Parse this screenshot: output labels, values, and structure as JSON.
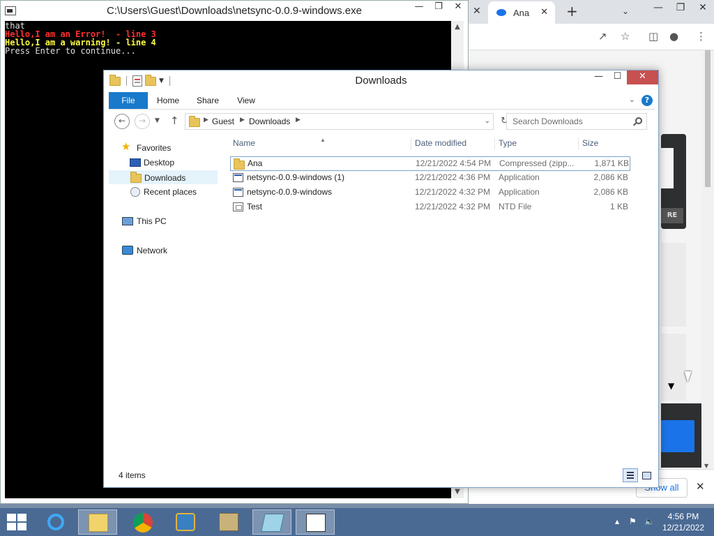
{
  "console": {
    "title": "C:\\Users\\Guest\\Downloads\\netsync-0.0.9-windows.exe",
    "lines": {
      "l1": "that",
      "l2": "Hello,I am an Error!  - line 3",
      "l3": "Hello,I am a warning! - line 4",
      "l4": "Press Enter to continue..."
    },
    "colors": {
      "error": "#ff3030",
      "warning": "#ffff40",
      "normal": "#e0e0e0"
    }
  },
  "browser": {
    "tab_label": "Ana",
    "partial_button": "RE",
    "show_all": "Show all",
    "accent": "#1a73e8"
  },
  "explorer": {
    "title": "Downloads",
    "ribbon": {
      "file": "File",
      "home": "Home",
      "share": "Share",
      "view": "View"
    },
    "address": {
      "segments": [
        "Guest",
        "Downloads"
      ]
    },
    "search_placeholder": "Search Downloads",
    "nav": {
      "favorites": "Favorites",
      "desktop": "Desktop",
      "downloads": "Downloads",
      "recent": "Recent places",
      "this_pc": "This PC",
      "network": "Network"
    },
    "columns": {
      "name": "Name",
      "date": "Date modified",
      "type": "Type",
      "size": "Size"
    },
    "files": [
      {
        "name": "Ana",
        "date": "12/21/2022 4:54 PM",
        "type": "Compressed (zipp...",
        "size": "1,871 KB",
        "icon": "zip-folder-icon"
      },
      {
        "name": "netsync-0.0.9-windows (1)",
        "date": "12/21/2022 4:36 PM",
        "type": "Application",
        "size": "2,086 KB",
        "icon": "application-icon"
      },
      {
        "name": "netsync-0.0.9-windows",
        "date": "12/21/2022 4:32 PM",
        "type": "Application",
        "size": "2,086 KB",
        "icon": "application-icon"
      },
      {
        "name": "Test",
        "date": "12/21/2022 4:32 PM",
        "type": "NTD File",
        "size": "1 KB",
        "icon": "generic-file-icon"
      }
    ],
    "status": "4 items",
    "accent": "#1979ca"
  },
  "taskbar": {
    "time": "4:56 PM",
    "date": "12/21/2022",
    "apps": [
      "internet-explorer-icon",
      "file-explorer-icon",
      "chrome-icon",
      "app-icon",
      "archive-icon",
      "notepad-icon",
      "console-icon"
    ]
  }
}
